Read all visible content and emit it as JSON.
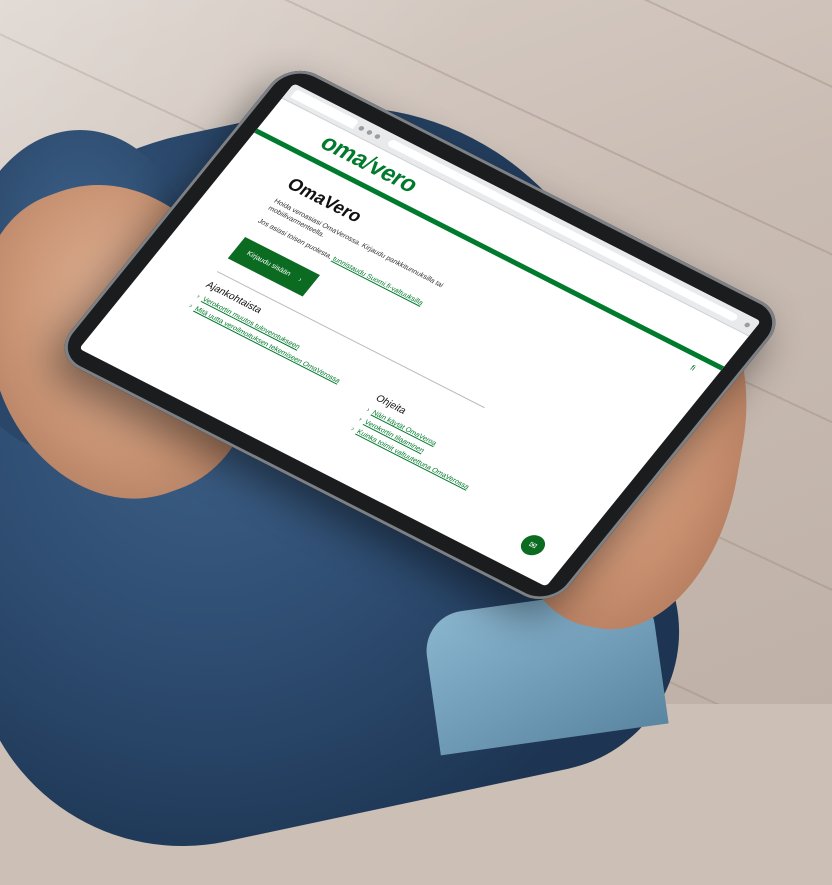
{
  "site": {
    "logo_left": "oma",
    "logo_slash": "/",
    "logo_right": "vero",
    "language": "fi"
  },
  "main": {
    "title": "OmaVero",
    "lead": "Hoida veroasiasi OmaVerossa. Kirjaudu pankkitunnuksilla tai mobiilivarmenteella.",
    "assist_text": "Jos asiasi toisen puolesta,",
    "assist_link": "tunnistaudu Suomi.fi-valtuuksilla",
    "login_button": "Kirjaudu sisään",
    "login_arrow": "›"
  },
  "current": {
    "heading": "Ajankohtaista",
    "items": [
      "Verokortin muutos tuloverotukseen",
      "Mitä uutta veroilmoituksen tekemiseen OmaVerossa"
    ]
  },
  "guides": {
    "heading": "Ohjeita",
    "items": [
      "Näin käytät OmaVeroa",
      "Verokortin tilaaminen",
      "Kuinka toimit valtuutettuna OmaVerossa"
    ]
  },
  "chat_icon": "chat-icon",
  "colors": {
    "brand_green": "#007a2c",
    "button_green": "#0a6b21"
  }
}
